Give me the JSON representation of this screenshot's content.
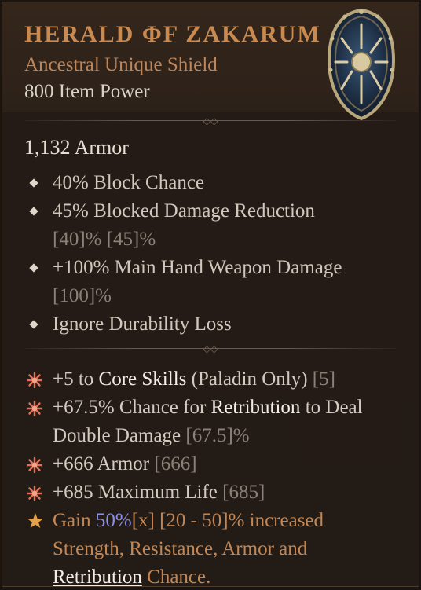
{
  "item": {
    "name": "HERALD ΦF ZAKARUM",
    "type_line": "Ancestral Unique Shield",
    "item_power": "800 Item Power",
    "icon": "shield-icon"
  },
  "base": {
    "armor": "1,132 Armor",
    "properties": [
      {
        "text": "40% Block Chance",
        "range": ""
      },
      {
        "text": "45% Blocked Damage Reduction",
        "range": "[40]% [45]%"
      },
      {
        "text": "+100% Main Hand Weapon Damage",
        "range": "[100]%"
      },
      {
        "text": "Ignore Durability Loss",
        "range": ""
      }
    ]
  },
  "affixes": [
    {
      "pre": "+5 to ",
      "key": "Core Skills",
      "post": " (Paladin Only) ",
      "range": "[5]"
    },
    {
      "pre": "+67.5% Chance for ",
      "key": "Retribution",
      "post": " to Deal Double Damage ",
      "range": "[67.5]%"
    },
    {
      "pre": "+666 Armor ",
      "key": "",
      "post": "",
      "range": "[666]"
    },
    {
      "pre": "+685 Maximum Life ",
      "key": "",
      "post": "",
      "range": "[685]"
    }
  ],
  "unique_power": {
    "pre": "Gain ",
    "value": "50%",
    "mult": "[x]",
    "range": " [20 - 50]% increased",
    "line2": "Strength, Resistance, Armor and",
    "keyword": "Retribution",
    "tail": " Chance."
  },
  "colors": {
    "unique": "#c98a52",
    "affix_star": "#e0725a",
    "unique_star": "#e3a24a",
    "value_blue": "#8d8fe8"
  }
}
